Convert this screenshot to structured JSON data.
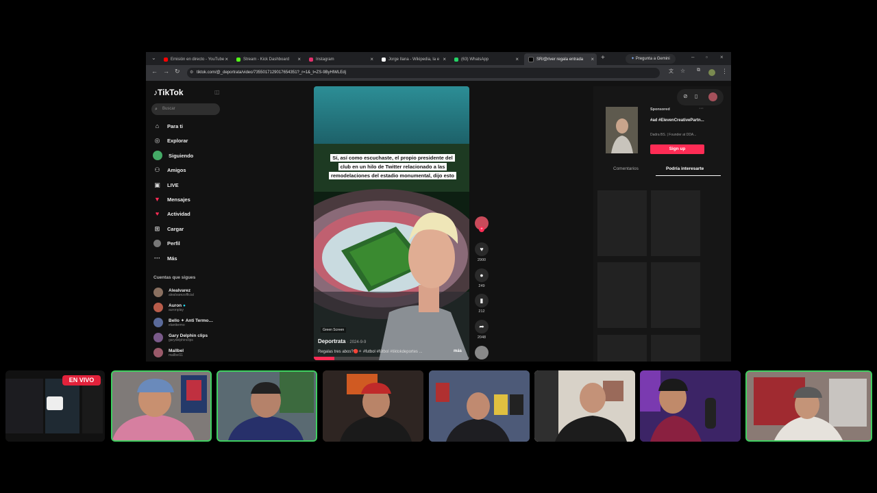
{
  "browser": {
    "tabs": [
      {
        "label": "Emisión en directo - YouTube",
        "color": "#ff0000"
      },
      {
        "label": "Stream - Kick Dashboard",
        "color": "#53fc18"
      },
      {
        "label": "Instagram",
        "color": "#e1306c"
      },
      {
        "label": "Jorge Ilana - Wikipedia, la e",
        "color": "#ffffff"
      },
      {
        "label": "(63) WhatsApp",
        "color": "#25d366"
      },
      {
        "label": "SR/@river regala entrada",
        "color": "#000000"
      }
    ],
    "gemini_label": "Pregunta a Gemini",
    "url": "tiktok.com/@_deportrata/video/7355017129017654351?_r=1&_t=ZS-9ByHlWLEdj"
  },
  "tiktok": {
    "logo": "TikTok",
    "search_placeholder": "Buscar",
    "nav": [
      {
        "label": "Para ti",
        "icon": "home-icon"
      },
      {
        "label": "Explorar",
        "icon": "compass-icon"
      },
      {
        "label": "Siguiendo",
        "icon": "following-icon"
      },
      {
        "label": "Amigos",
        "icon": "friends-icon"
      },
      {
        "label": "LIVE",
        "icon": "live-icon"
      },
      {
        "label": "Mensajes",
        "icon": "messages-icon"
      },
      {
        "label": "Actividad",
        "icon": "activity-icon"
      },
      {
        "label": "Cargar",
        "icon": "upload-icon"
      },
      {
        "label": "Perfil",
        "icon": "profile-icon"
      },
      {
        "label": "Más",
        "icon": "more-icon"
      }
    ],
    "following_title": "Cuentas que sigues",
    "following": [
      {
        "name": "Alealvarez",
        "handle": "alealvarezofficial"
      },
      {
        "name": "Auron",
        "handle": "auronplay"
      },
      {
        "name": "Bello ✦ Anti Termo…",
        "handle": "elanttermo"
      },
      {
        "name": "Gary Delphin clips",
        "handle": "garydelphinclips"
      },
      {
        "name": "Mallbel",
        "handle": "mallbel11"
      }
    ]
  },
  "video": {
    "caption": "Sí, así como escuchaste, el propio presidente del club en un hilo de Twitter relacionado a las remodelaciones del estadio monumental, dijo esto",
    "overlay_label": "Green Screen",
    "author": "Deportrata",
    "date": "· 2024-9-9",
    "description": "Regalas tres abos?🔴⚪ #futbol #fútbol #tiktokdeportes ...",
    "more": "más",
    "actions": [
      {
        "icon": "heart-icon",
        "count": "2900"
      },
      {
        "icon": "comment-icon",
        "count": "249"
      },
      {
        "icon": "bookmark-icon",
        "count": "212"
      },
      {
        "icon": "share-icon",
        "count": "2048"
      }
    ]
  },
  "ad": {
    "sponsored": "Sponsored",
    "title": "#ad #ElevenCreativePartn...",
    "subtitle": "Dadra BS. | Founder at DDA...",
    "signup": "Sign up"
  },
  "panel_tabs": {
    "comments": "Comentarios",
    "maybe": "Podría interesarte"
  },
  "live_badge": "EN VIVO",
  "colors": {
    "accent": "#fe2c55",
    "live": "#e2223b",
    "cam_border": "#3fd060"
  }
}
